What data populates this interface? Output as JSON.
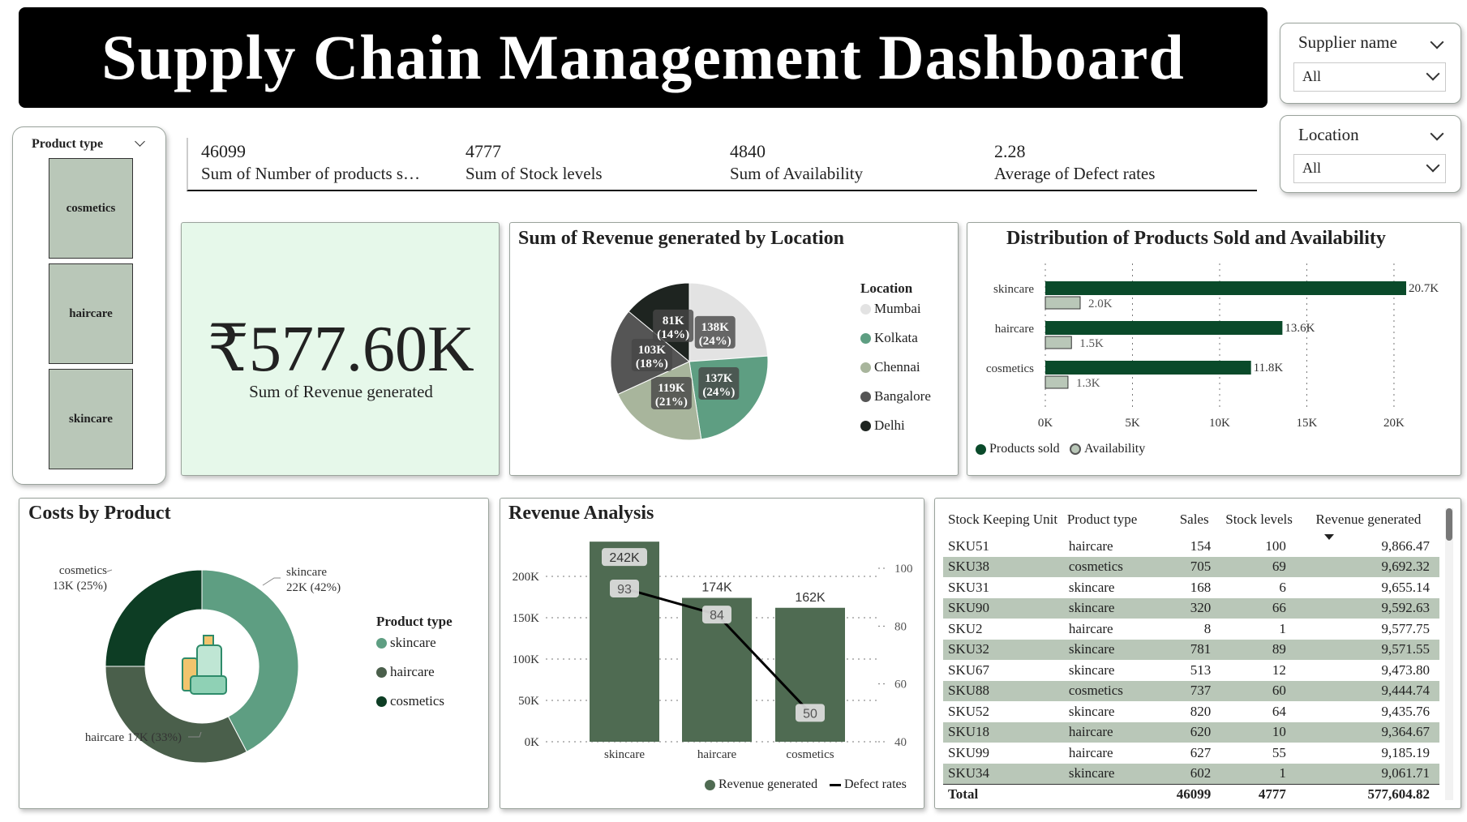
{
  "title": "Supply Chain Management Dashboard",
  "slicers": {
    "supplier": {
      "label": "Supplier name",
      "value": "All"
    },
    "location": {
      "label": "Location",
      "value": "All"
    },
    "product_type": {
      "label": "Product type",
      "items": [
        "cosmetics",
        "haircare",
        "skincare"
      ]
    }
  },
  "kpis": [
    {
      "value": "46099",
      "label": "Sum of Number of products s…"
    },
    {
      "value": "4777",
      "label": "Sum of Stock levels"
    },
    {
      "value": "4840",
      "label": "Sum of Availability"
    },
    {
      "value": "2.28",
      "label": "Average of Defect rates"
    }
  ],
  "revenue_card": {
    "value": "₹577.60K",
    "label": "Sum of Revenue generated"
  },
  "colors": {
    "dark_green": "#0a4a2a",
    "mid_green": "#5e9e82",
    "bar_green": "#4f6b52",
    "light_fill": "#e6f8ea",
    "tile": "#b9c7b8",
    "row_alt": "#b9c7b8"
  },
  "chart_data": [
    {
      "type": "pie",
      "title": "Sum of Revenue generated by Location",
      "legend_title": "Location",
      "legend_position": "right",
      "slices": [
        {
          "name": "Mumbai",
          "value": 138,
          "label": "138K",
          "pct": "(24%)",
          "color": "#e3e3e3"
        },
        {
          "name": "Kolkata",
          "value": 137,
          "label": "137K",
          "pct": "(24%)",
          "color": "#5e9e82"
        },
        {
          "name": "Chennai",
          "value": 119,
          "label": "119K",
          "pct": "(21%)",
          "color": "#a8b59c"
        },
        {
          "name": "Bangalore",
          "value": 103,
          "label": "103K",
          "pct": "(18%)",
          "color": "#555555"
        },
        {
          "name": "Delhi",
          "value": 81,
          "label": "81K",
          "pct": "(14%)",
          "color": "#1e2420"
        }
      ]
    },
    {
      "type": "bar",
      "orientation": "horizontal",
      "title": "Distribution of Products Sold and Availability",
      "categories": [
        "skincare",
        "haircare",
        "cosmetics"
      ],
      "series": [
        {
          "name": "Products sold",
          "values": [
            20.7,
            13.6,
            11.8
          ],
          "labels": [
            "20.7K",
            "13.6K",
            "11.8K"
          ],
          "color": "#0a4a2a"
        },
        {
          "name": "Availability",
          "values": [
            2.0,
            1.5,
            1.3
          ],
          "labels": [
            "2.0K",
            "1.5K",
            "1.3K"
          ],
          "color": "#b9c7b8"
        }
      ],
      "xticks": [
        "0K",
        "5K",
        "10K",
        "15K",
        "20K"
      ],
      "xlim": [
        0,
        20.7
      ],
      "grid": "vertical dotted",
      "legend_position": "bottom-left"
    },
    {
      "type": "pie",
      "title": "Costs by Product",
      "donut": true,
      "legend_title": "Product type",
      "legend_position": "right",
      "slices": [
        {
          "name": "skincare",
          "value": 22,
          "label": "skincare",
          "sub": "22K (42%)",
          "color": "#5e9e82"
        },
        {
          "name": "haircare",
          "value": 17,
          "label": "haircare 17K (33%)",
          "sub": "",
          "color": "#4a5f4b"
        },
        {
          "name": "cosmetics",
          "value": 13,
          "label": "cosmetics",
          "sub": "13K (25%)",
          "color": "#0d3d24"
        }
      ]
    },
    {
      "type": "bar",
      "title": "Revenue Analysis",
      "categories": [
        "skincare",
        "haircare",
        "cosmetics"
      ],
      "series": [
        {
          "name": "Revenue generated",
          "values": [
            242,
            174,
            162
          ],
          "labels": [
            "242K",
            "174K",
            "162K"
          ],
          "color": "#4f6b52"
        },
        {
          "name": "Defect rates",
          "type": "line",
          "values": [
            93,
            84,
            50
          ],
          "labels": [
            "93",
            "84",
            "50"
          ],
          "color": "#000000"
        }
      ],
      "yticks": [
        "0K",
        "50K",
        "100K",
        "150K",
        "200K"
      ],
      "ylim": [
        0,
        250
      ],
      "y2ticks": [
        "40",
        "60",
        "80",
        "100"
      ],
      "y2lim": [
        40,
        100
      ],
      "grid": "horizontal dotted",
      "legend_position": "bottom"
    },
    {
      "type": "table",
      "columns": [
        "Stock Keeping Unit",
        "Product type",
        "Sales",
        "Stock levels",
        "Revenue generated"
      ],
      "rows": [
        [
          "SKU51",
          "haircare",
          "154",
          "100",
          "9,866.47"
        ],
        [
          "SKU38",
          "cosmetics",
          "705",
          "69",
          "9,692.32"
        ],
        [
          "SKU31",
          "skincare",
          "168",
          "6",
          "9,655.14"
        ],
        [
          "SKU90",
          "skincare",
          "320",
          "66",
          "9,592.63"
        ],
        [
          "SKU2",
          "haircare",
          "8",
          "1",
          "9,577.75"
        ],
        [
          "SKU32",
          "skincare",
          "781",
          "89",
          "9,571.55"
        ],
        [
          "SKU67",
          "skincare",
          "513",
          "12",
          "9,473.80"
        ],
        [
          "SKU88",
          "cosmetics",
          "737",
          "60",
          "9,444.74"
        ],
        [
          "SKU52",
          "skincare",
          "820",
          "64",
          "9,435.76"
        ],
        [
          "SKU18",
          "haircare",
          "620",
          "10",
          "9,364.67"
        ],
        [
          "SKU99",
          "haircare",
          "627",
          "55",
          "9,185.19"
        ],
        [
          "SKU34",
          "skincare",
          "602",
          "1",
          "9,061.71"
        ]
      ],
      "total": [
        "Total",
        "",
        "46099",
        "4777",
        "577,604.82"
      ]
    }
  ]
}
